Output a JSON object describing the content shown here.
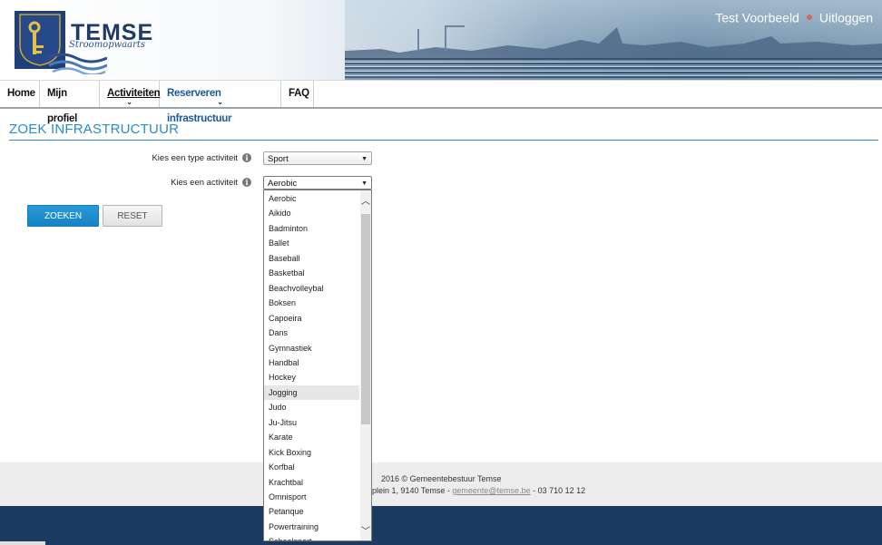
{
  "header": {
    "brand": "TEMSE",
    "tagline": "Stroomopwaarts",
    "user_name": "Test Voorbeeld",
    "logout_label": "Uitloggen"
  },
  "nav": {
    "items": [
      {
        "label": "Home"
      },
      {
        "label": "Mijn profiel"
      },
      {
        "label": "Activiteiten"
      },
      {
        "label": "Reserveren infrastructuur"
      },
      {
        "label": "FAQ"
      }
    ]
  },
  "page": {
    "title": "ZOEK INFRASTRUCTUUR"
  },
  "form": {
    "type_label": "Kies een type activiteit",
    "type_value": "Sport",
    "activity_label": "Kies een activiteit",
    "activity_value": "Aerobic",
    "search_button": "ZOEKEN",
    "reset_button": "RESET"
  },
  "dropdown": {
    "options": [
      "Aerobic",
      "Aikido",
      "Badminton",
      "Ballet",
      "Baseball",
      "Basketbal",
      "Beachvolleybal",
      "Boksen",
      "Capoeira",
      "Dans",
      "Gymnastiek",
      "Handbal",
      "Hockey",
      "Jogging",
      "Judo",
      "Ju-Jitsu",
      "Karate",
      "Kick Boxing",
      "Korfbal",
      "Krachtbal",
      "Omnisport",
      "Petanque",
      "Powertraining",
      "Schoolsport"
    ],
    "highlighted": "Jogging"
  },
  "footer": {
    "line1": "2016 © Gemeentebestuur Temse",
    "line2_prefix": "elplein 1, 9140 Temse - ",
    "email": "gemeente@temse.be",
    "line2_suffix": " - 03 710 12 12"
  },
  "colors": {
    "accent": "#2b8cc4",
    "primary_button": "#1a8ccf",
    "band": "#1b3b63"
  }
}
